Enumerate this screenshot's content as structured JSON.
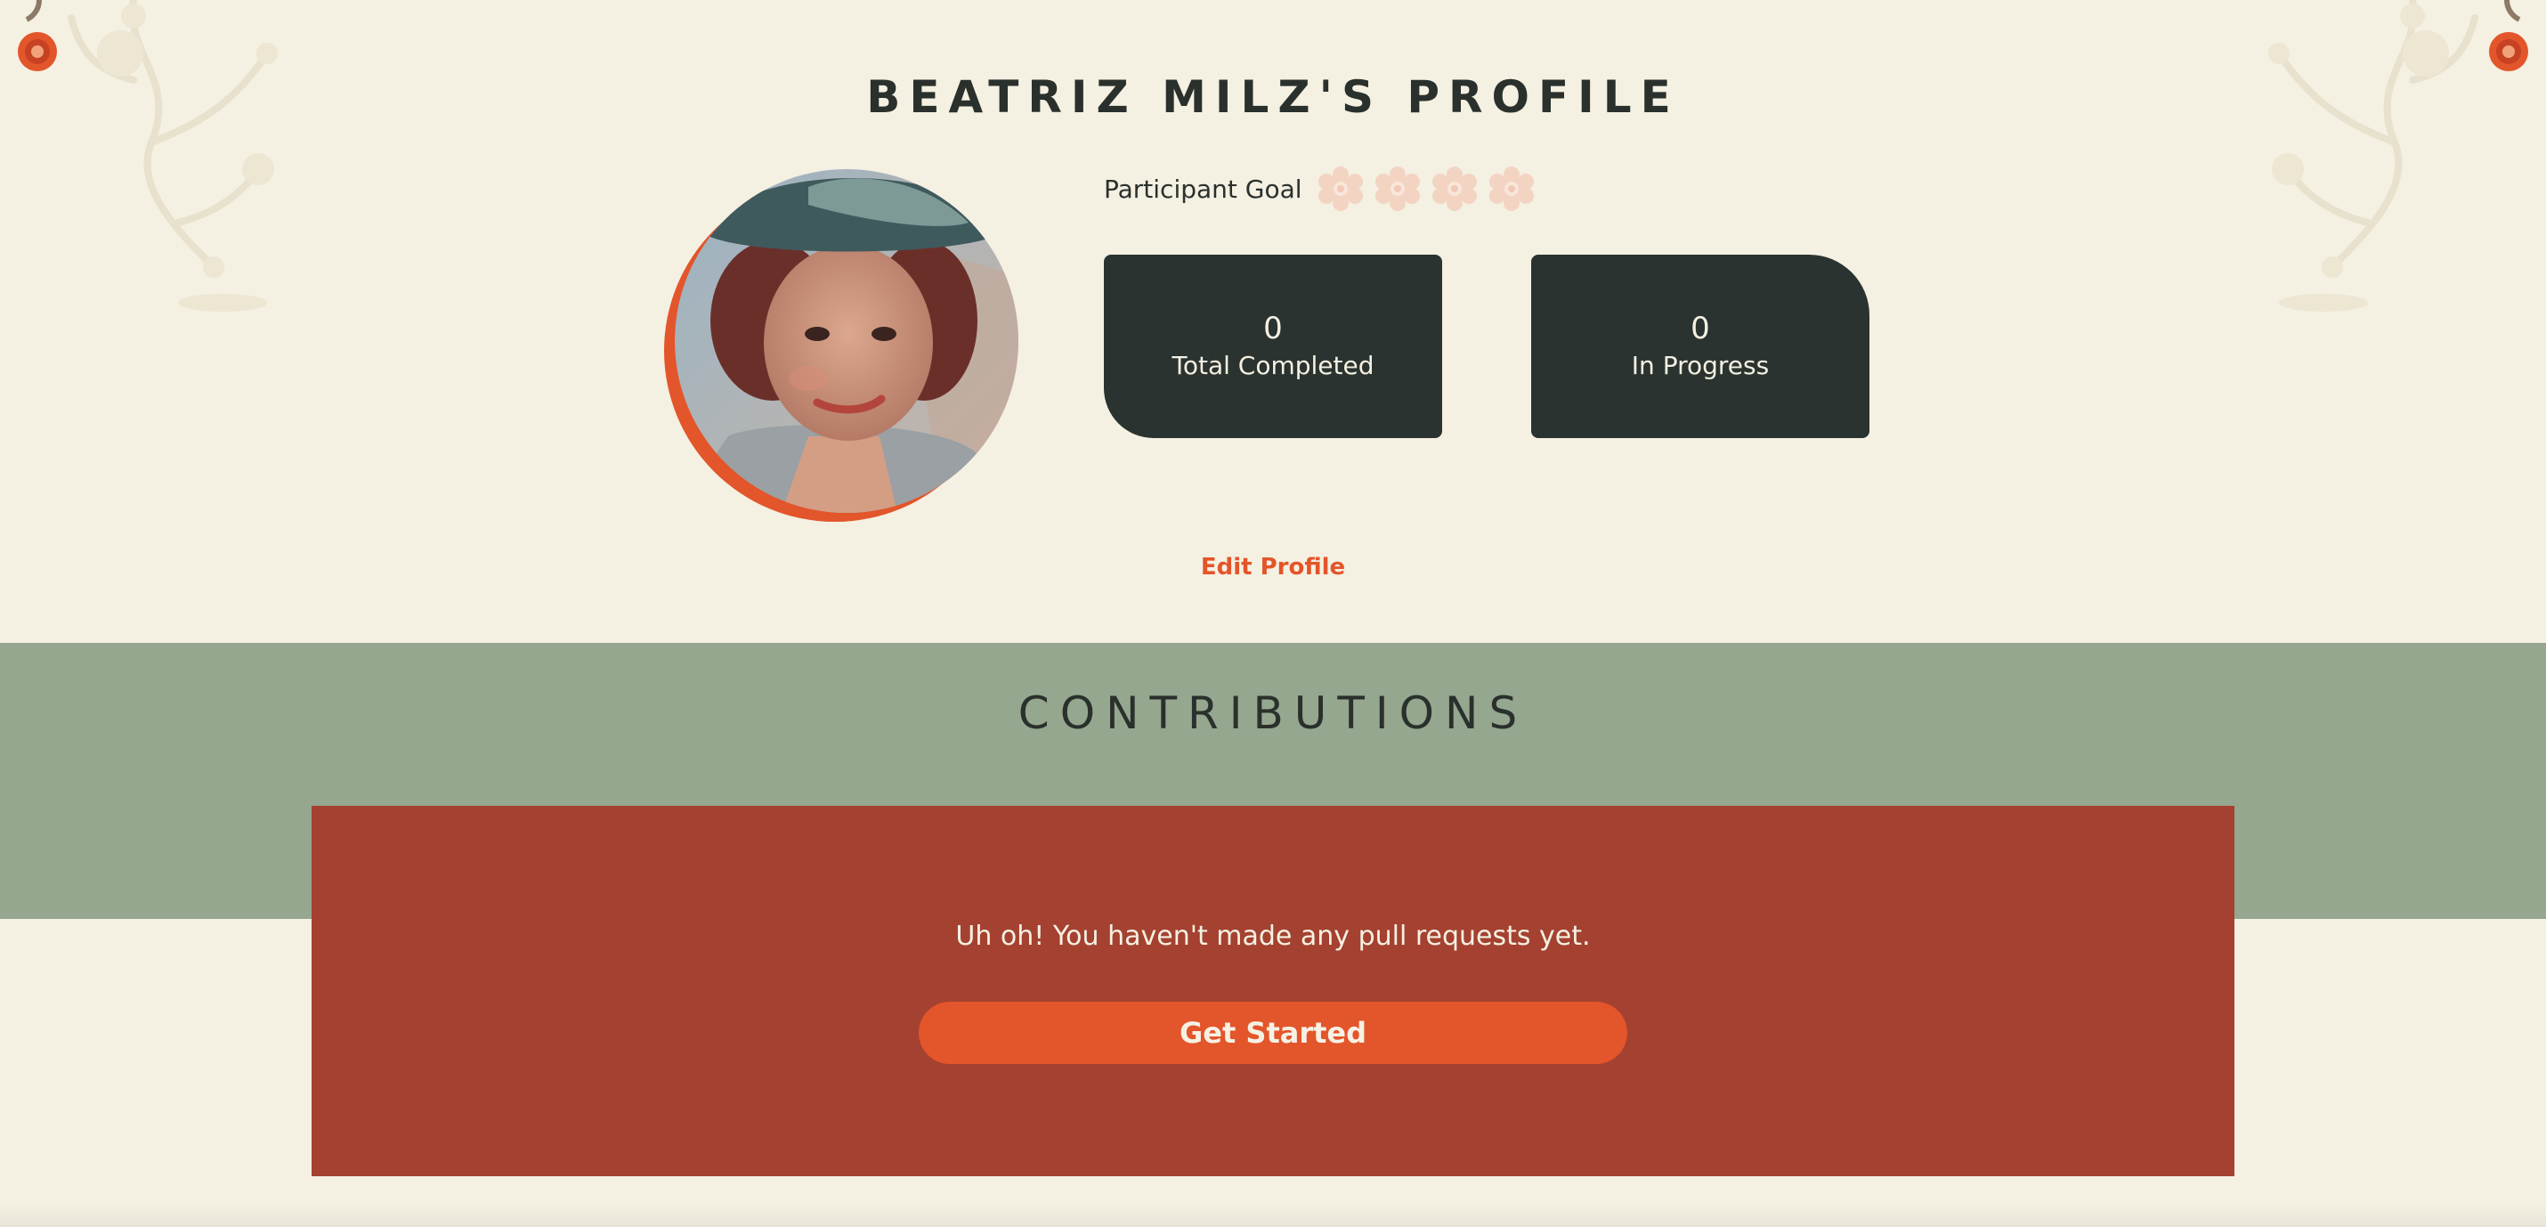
{
  "profile": {
    "title": "BEATRIZ MILZ'S PROFILE",
    "avatar_alt": "Profile photo",
    "goal_label": "Participant Goal",
    "goal_icons": [
      "flower-icon",
      "flower-icon",
      "flower-icon",
      "flower-icon"
    ],
    "goal_reached": 0,
    "goal_total": 4,
    "stats": [
      {
        "value": "0",
        "label": "Total Completed"
      },
      {
        "value": "0",
        "label": "In Progress"
      }
    ],
    "edit_label": "Edit Profile"
  },
  "contributions": {
    "title": "CONTRIBUTIONS",
    "empty_message": "Uh oh! You haven't made any pull requests yet.",
    "cta_label": "Get Started"
  },
  "colors": {
    "background": "#f4f0e2",
    "dark": "#2a332f",
    "accent": "#e3552a",
    "sage": "#95a78f",
    "rust": "#a54130"
  }
}
